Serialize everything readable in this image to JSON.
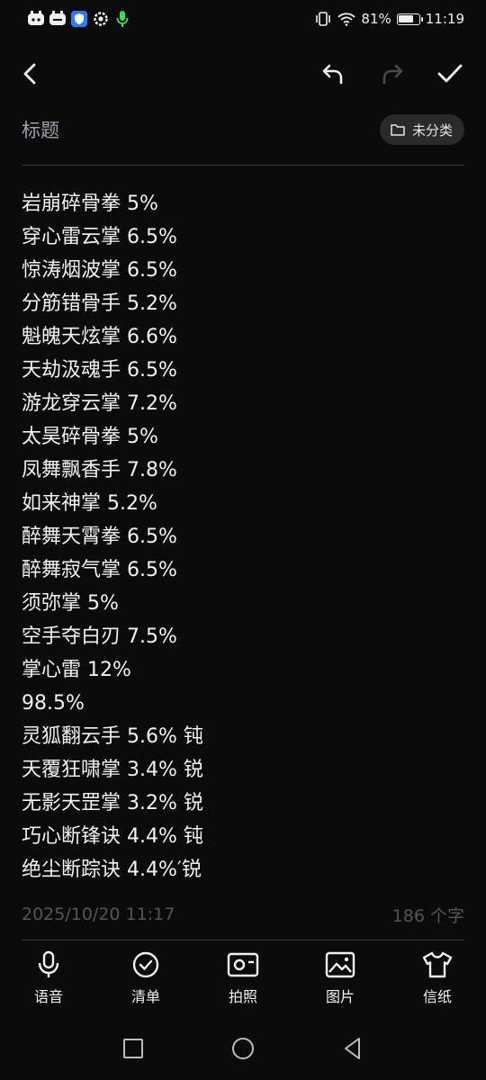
{
  "status_bar": {
    "battery_percent": "81%",
    "battery_level": 0.81,
    "time": "11:19",
    "icons": [
      "app-icon-1",
      "app-icon-2",
      "shield-icon",
      "settings-icon",
      "mic-icon",
      "vibrate-icon",
      "wifi-icon"
    ]
  },
  "toolbar": {
    "back_icon": "chevron-left-icon",
    "undo_icon": "undo-icon",
    "redo_icon": "redo-icon",
    "confirm_icon": "check-icon"
  },
  "note": {
    "title_placeholder": "标题",
    "category_label": "未分类",
    "lines": [
      "岩崩碎骨拳 5%",
      "穿心雷云掌 6.5%",
      "惊涛烟波掌 6.5%",
      "分筋错骨手 5.2%",
      "魁魄天炫掌 6.6%",
      "天劫汲魂手 6.5%",
      "游龙穿云掌 7.2%",
      "太昊碎骨拳 5%",
      "凤舞飘香手 7.8%",
      "如来神掌 5.2%",
      "醉舞天霄拳 6.5%",
      "醉舞寂气掌 6.5%",
      "须弥掌 5%",
      "空手夺白刃 7.5%",
      "掌心雷 12%",
      "98.5%",
      "灵狐翻云手 5.6% 钝",
      "天覆狂啸掌 3.4% 锐",
      "无影天罡掌 3.2% 锐",
      "巧心断锋诀 4.4% 钝",
      "绝尘断踪诀 4.4%′锐"
    ],
    "timestamp": "2025/10/20 11:17",
    "char_count": "186 个字"
  },
  "actions": [
    {
      "label": "语音",
      "icon": "mic-icon"
    },
    {
      "label": "清单",
      "icon": "checklist-icon"
    },
    {
      "label": "拍照",
      "icon": "camera-icon"
    },
    {
      "label": "图片",
      "icon": "image-icon"
    },
    {
      "label": "信纸",
      "icon": "shirt-icon"
    }
  ],
  "nav": {
    "icons": [
      "recent-apps-icon",
      "home-icon",
      "back-icon"
    ]
  },
  "colors": {
    "background": "#0b0b0b",
    "text": "#f2f2f2",
    "placeholder": "#9aa3ad",
    "chip_bg": "#2a2a2a",
    "muted": "#555555",
    "status_green": "#3ddc57",
    "status_blue": "#2e7cf6"
  }
}
